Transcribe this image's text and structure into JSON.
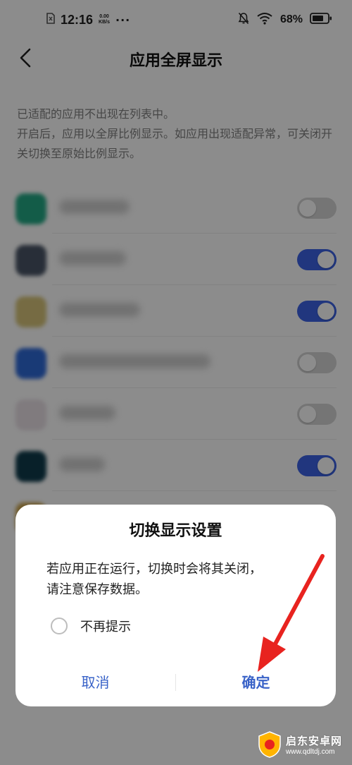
{
  "status_bar": {
    "time": "12:16",
    "net_speed_value": "0.00",
    "net_speed_unit": "KB/s",
    "more": "···",
    "battery": "68%",
    "icons": [
      "sim-icon",
      "mute-bell-icon",
      "wifi-icon",
      "battery-icon"
    ]
  },
  "header": {
    "title": "应用全屏显示",
    "back_icon": "chevron-left-icon"
  },
  "description": {
    "line1": "已适配的应用不出现在列表中。",
    "line2": "开启后，应用以全屏比例显示。如应用出现适配异常，可关闭开关切换至原始比例显示。"
  },
  "apps": [
    {
      "icon_color": "#23a884",
      "switch_on": false
    },
    {
      "icon_color": "#4a5566",
      "switch_on": true
    },
    {
      "icon_color": "#d7c47a",
      "switch_on": true
    },
    {
      "icon_color": "#2f6ad8",
      "switch_on": false
    },
    {
      "icon_color": "#e9e0e6",
      "switch_on": false
    },
    {
      "icon_color": "#0f3b4c",
      "switch_on": true
    }
  ],
  "dialog": {
    "title": "切换显示设置",
    "message_line1": "若应用正在运行，切换时会将其关闭，",
    "message_line2": "请注意保存数据。",
    "checkbox_label": "不再提示",
    "checkbox_checked": false,
    "cancel_label": "取消",
    "confirm_label": "确定"
  },
  "watermark": {
    "brand": "启东安卓网",
    "url": "www.qdltdj.com"
  },
  "colors": {
    "accent": "#3a63c8",
    "switch_on": "#3c63e5",
    "annotation_arrow": "#e8231f"
  }
}
